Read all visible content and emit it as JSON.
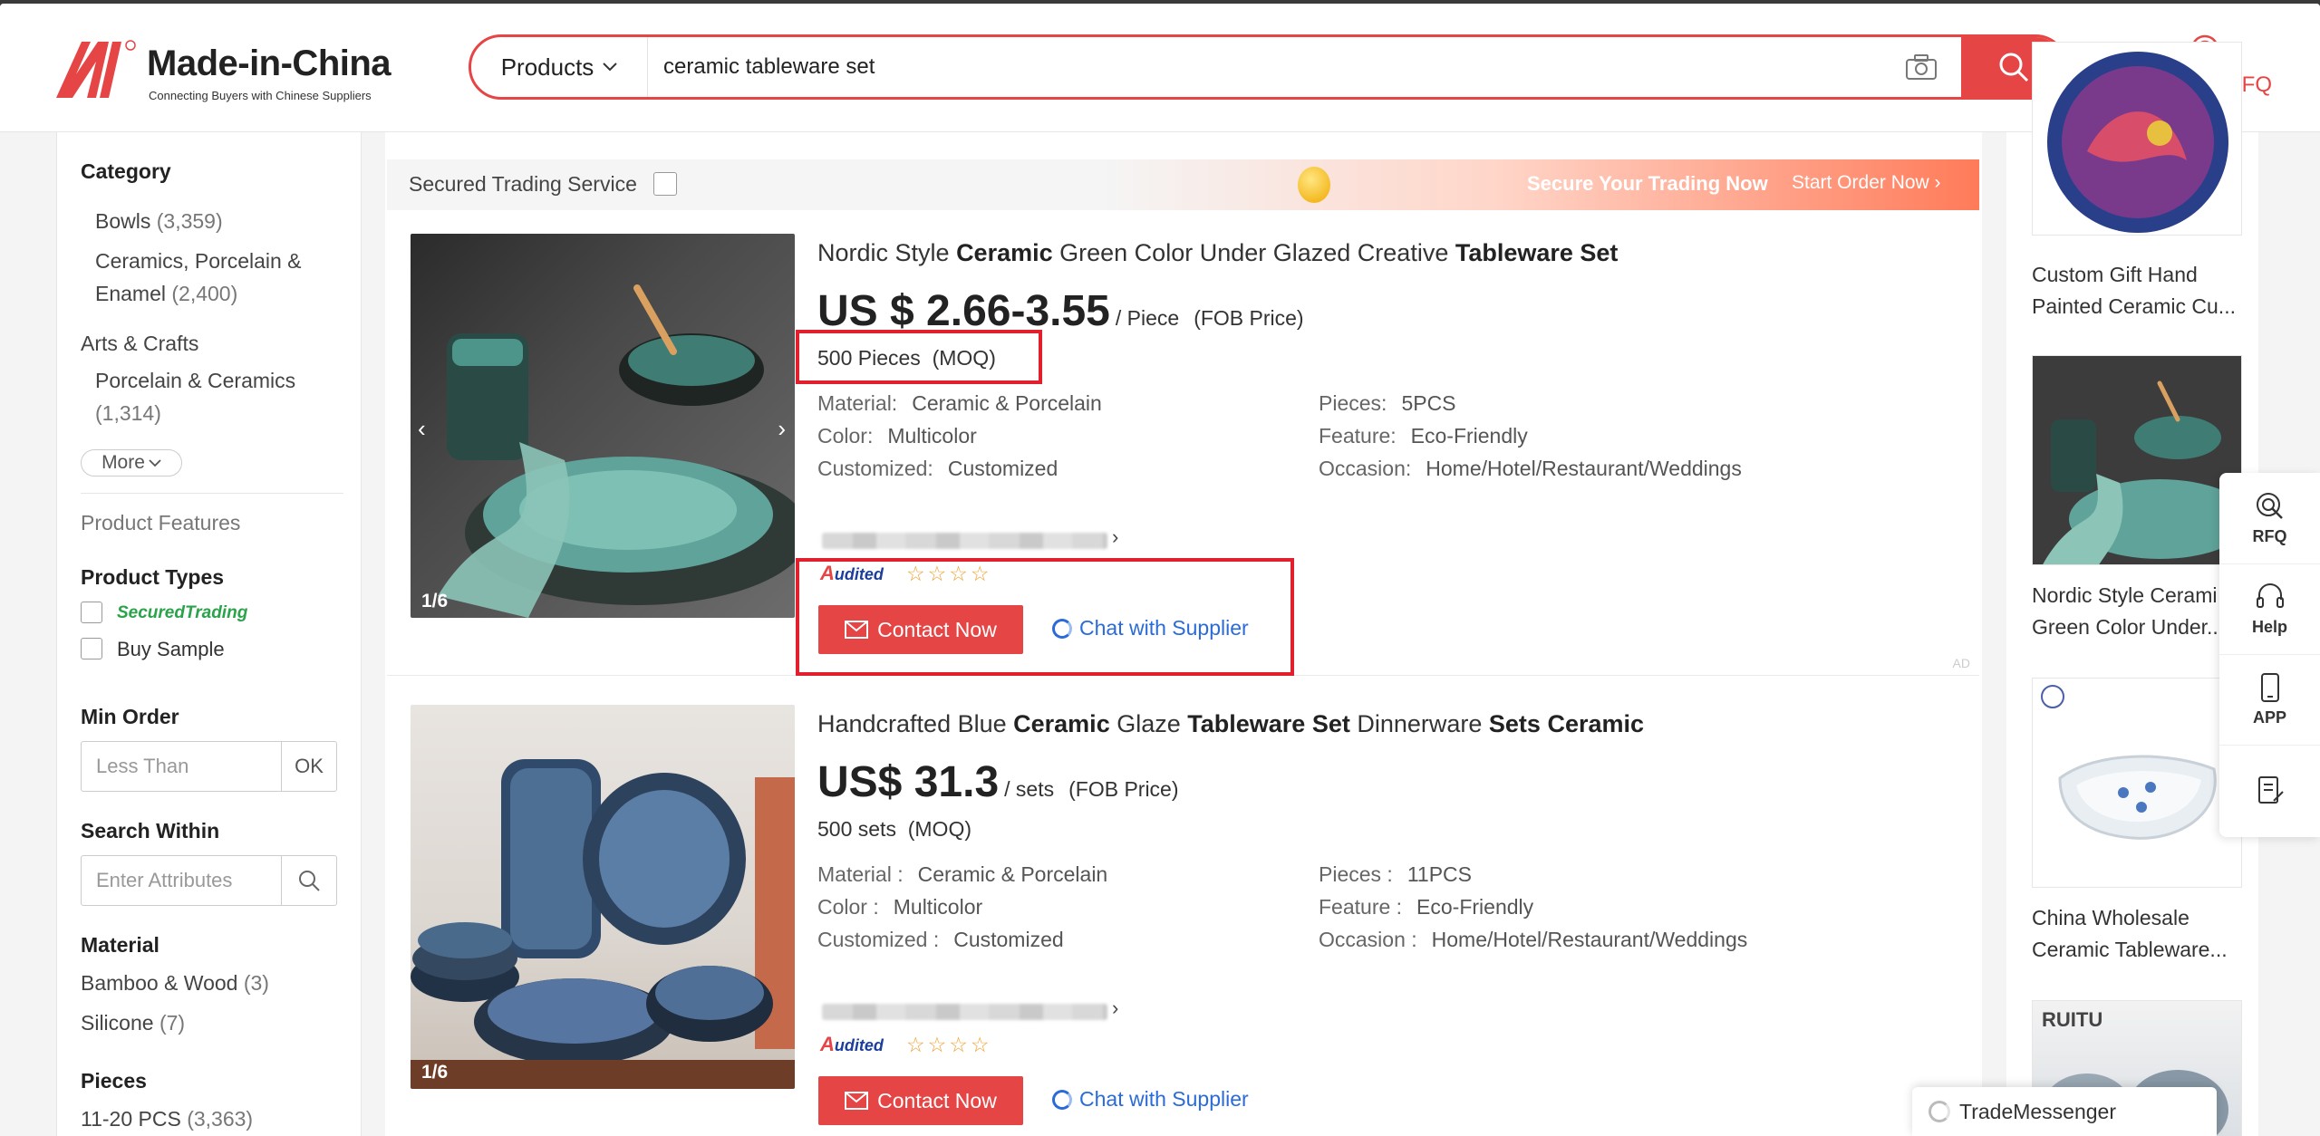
{
  "header": {
    "logo_text": "Made-in-China",
    "logo_tagline": "Connecting Buyers with Chinese Suppliers",
    "search_category": "Products",
    "search_value": "ceramic tableware set",
    "post_rfq": "Post My RFQ"
  },
  "sidebar": {
    "category_title": "Category",
    "categories": [
      {
        "name": "Bowls",
        "count": "(3,359)"
      },
      {
        "name_line1": "Ceramics, Porcelain &",
        "name_line2": "Enamel",
        "count": "(2,400)"
      }
    ],
    "arts_crafts": "Arts & Crafts",
    "porcelain": {
      "name": "Porcelain & Ceramics",
      "count": "(1,314)"
    },
    "more": "More",
    "product_features": "Product Features",
    "product_types_title": "Product Types",
    "secured_trading": "SecuredTrading",
    "buy_sample": "Buy Sample",
    "min_order_title": "Min Order",
    "min_order_placeholder": "Less Than",
    "min_order_ok": "OK",
    "search_within_title": "Search Within",
    "search_within_placeholder": "Enter Attributes",
    "material_title": "Material",
    "materials": [
      {
        "name": "Bamboo & Wood",
        "count": "(3)"
      },
      {
        "name": "Silicone",
        "count": "(7)"
      }
    ],
    "pieces_title": "Pieces",
    "pieces": [
      {
        "name": "11-20 PCS",
        "count": "(3,363)"
      }
    ]
  },
  "secure_bar": {
    "label": "Secured Trading Service",
    "cta": "Secure Your Trading Now",
    "start": "Start Order Now ›"
  },
  "products": [
    {
      "title_parts": [
        "Nordic Style ",
        "Ceramic",
        " Green Color Under Glazed Creative ",
        "Tableware Set"
      ],
      "price": "US $ 2.66-3.55",
      "unit": "/ Piece",
      "price_type": "(FOB Price)",
      "moq": "500 Pieces",
      "moq_label": "(MOQ)",
      "attrs_left": [
        {
          "k": "Material:",
          "v": "Ceramic & Porcelain"
        },
        {
          "k": "Color:",
          "v": "Multicolor"
        },
        {
          "k": "Customized:",
          "v": "Customized"
        }
      ],
      "attrs_right": [
        {
          "k": "Pieces:",
          "v": "5PCS"
        },
        {
          "k": "Feature:",
          "v": "Eco-Friendly"
        },
        {
          "k": "Occasion:",
          "v": "Home/Hotel/Restaurant/Weddings"
        }
      ],
      "image_count": "1/6",
      "audited": "udited",
      "stars": "☆☆☆☆",
      "contact": "Contact Now",
      "chat": "Chat with Supplier",
      "ad": "AD"
    },
    {
      "title_parts": [
        "Handcrafted Blue ",
        "Ceramic",
        " Glaze ",
        "Tableware Set",
        " Dinnerware ",
        "Sets Ceramic"
      ],
      "price": "US$ 31.3",
      "unit": "/ sets",
      "price_type": "(FOB Price)",
      "moq": "500 sets",
      "moq_label": "(MOQ)",
      "attrs_left": [
        {
          "k": "Material :",
          "v": "Ceramic & Porcelain"
        },
        {
          "k": "Color :",
          "v": "Multicolor"
        },
        {
          "k": "Customized :",
          "v": "Customized"
        }
      ],
      "attrs_right": [
        {
          "k": "Pieces :",
          "v": "11PCS"
        },
        {
          "k": "Feature :",
          "v": "Eco-Friendly"
        },
        {
          "k": "Occasion :",
          "v": "Home/Hotel/Restaurant/Weddings"
        }
      ],
      "image_count": "1/6",
      "audited": "udited",
      "stars": "☆☆☆☆",
      "contact": "Contact Now",
      "chat": "Chat with Supplier"
    }
  ],
  "rail": [
    {
      "line1": "Custom Gift Hand",
      "line2": "Painted Ceramic Cu..."
    },
    {
      "line1": "Nordic Style Cerami",
      "line2": "Green Color Under..."
    },
    {
      "line1": "China Wholesale",
      "line2": "Ceramic Tableware..."
    },
    {
      "brand": "RUITU"
    }
  ],
  "tools": {
    "rfq": "RFQ",
    "help": "Help",
    "app": "APP"
  },
  "trade_messenger": "TradeMessenger",
  "colors": {
    "brand_red": "#e64545",
    "highlight_red": "#e0202c",
    "link_blue": "#2a6bd8"
  }
}
